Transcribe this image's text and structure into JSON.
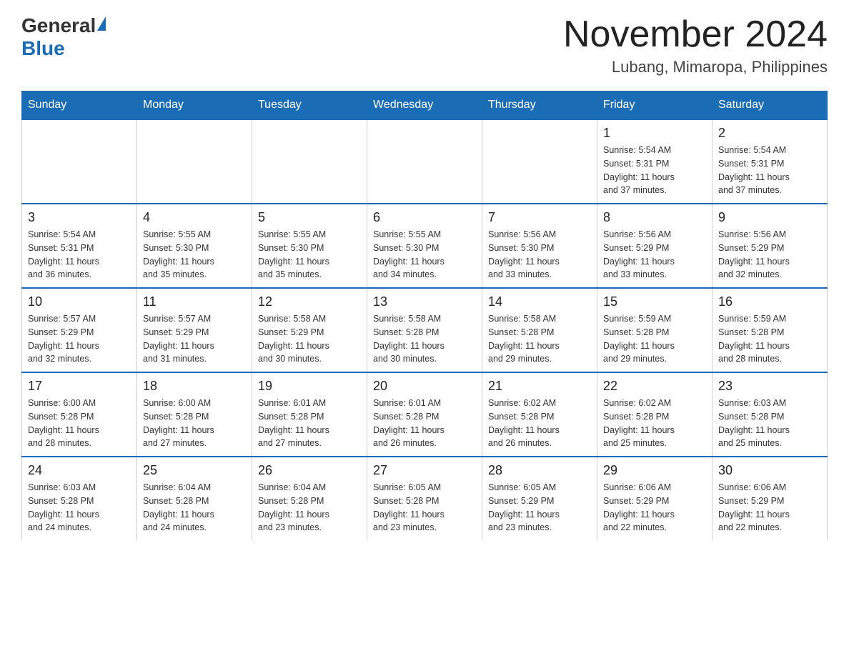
{
  "header": {
    "logo_general": "General",
    "logo_blue": "Blue",
    "title": "November 2024",
    "subtitle": "Lubang, Mimaropa, Philippines"
  },
  "weekdays": [
    "Sunday",
    "Monday",
    "Tuesday",
    "Wednesday",
    "Thursday",
    "Friday",
    "Saturday"
  ],
  "weeks": [
    [
      {
        "day": "",
        "info": ""
      },
      {
        "day": "",
        "info": ""
      },
      {
        "day": "",
        "info": ""
      },
      {
        "day": "",
        "info": ""
      },
      {
        "day": "",
        "info": ""
      },
      {
        "day": "1",
        "info": "Sunrise: 5:54 AM\nSunset: 5:31 PM\nDaylight: 11 hours\nand 37 minutes."
      },
      {
        "day": "2",
        "info": "Sunrise: 5:54 AM\nSunset: 5:31 PM\nDaylight: 11 hours\nand 37 minutes."
      }
    ],
    [
      {
        "day": "3",
        "info": "Sunrise: 5:54 AM\nSunset: 5:31 PM\nDaylight: 11 hours\nand 36 minutes."
      },
      {
        "day": "4",
        "info": "Sunrise: 5:55 AM\nSunset: 5:30 PM\nDaylight: 11 hours\nand 35 minutes."
      },
      {
        "day": "5",
        "info": "Sunrise: 5:55 AM\nSunset: 5:30 PM\nDaylight: 11 hours\nand 35 minutes."
      },
      {
        "day": "6",
        "info": "Sunrise: 5:55 AM\nSunset: 5:30 PM\nDaylight: 11 hours\nand 34 minutes."
      },
      {
        "day": "7",
        "info": "Sunrise: 5:56 AM\nSunset: 5:30 PM\nDaylight: 11 hours\nand 33 minutes."
      },
      {
        "day": "8",
        "info": "Sunrise: 5:56 AM\nSunset: 5:29 PM\nDaylight: 11 hours\nand 33 minutes."
      },
      {
        "day": "9",
        "info": "Sunrise: 5:56 AM\nSunset: 5:29 PM\nDaylight: 11 hours\nand 32 minutes."
      }
    ],
    [
      {
        "day": "10",
        "info": "Sunrise: 5:57 AM\nSunset: 5:29 PM\nDaylight: 11 hours\nand 32 minutes."
      },
      {
        "day": "11",
        "info": "Sunrise: 5:57 AM\nSunset: 5:29 PM\nDaylight: 11 hours\nand 31 minutes."
      },
      {
        "day": "12",
        "info": "Sunrise: 5:58 AM\nSunset: 5:29 PM\nDaylight: 11 hours\nand 30 minutes."
      },
      {
        "day": "13",
        "info": "Sunrise: 5:58 AM\nSunset: 5:28 PM\nDaylight: 11 hours\nand 30 minutes."
      },
      {
        "day": "14",
        "info": "Sunrise: 5:58 AM\nSunset: 5:28 PM\nDaylight: 11 hours\nand 29 minutes."
      },
      {
        "day": "15",
        "info": "Sunrise: 5:59 AM\nSunset: 5:28 PM\nDaylight: 11 hours\nand 29 minutes."
      },
      {
        "day": "16",
        "info": "Sunrise: 5:59 AM\nSunset: 5:28 PM\nDaylight: 11 hours\nand 28 minutes."
      }
    ],
    [
      {
        "day": "17",
        "info": "Sunrise: 6:00 AM\nSunset: 5:28 PM\nDaylight: 11 hours\nand 28 minutes."
      },
      {
        "day": "18",
        "info": "Sunrise: 6:00 AM\nSunset: 5:28 PM\nDaylight: 11 hours\nand 27 minutes."
      },
      {
        "day": "19",
        "info": "Sunrise: 6:01 AM\nSunset: 5:28 PM\nDaylight: 11 hours\nand 27 minutes."
      },
      {
        "day": "20",
        "info": "Sunrise: 6:01 AM\nSunset: 5:28 PM\nDaylight: 11 hours\nand 26 minutes."
      },
      {
        "day": "21",
        "info": "Sunrise: 6:02 AM\nSunset: 5:28 PM\nDaylight: 11 hours\nand 26 minutes."
      },
      {
        "day": "22",
        "info": "Sunrise: 6:02 AM\nSunset: 5:28 PM\nDaylight: 11 hours\nand 25 minutes."
      },
      {
        "day": "23",
        "info": "Sunrise: 6:03 AM\nSunset: 5:28 PM\nDaylight: 11 hours\nand 25 minutes."
      }
    ],
    [
      {
        "day": "24",
        "info": "Sunrise: 6:03 AM\nSunset: 5:28 PM\nDaylight: 11 hours\nand 24 minutes."
      },
      {
        "day": "25",
        "info": "Sunrise: 6:04 AM\nSunset: 5:28 PM\nDaylight: 11 hours\nand 24 minutes."
      },
      {
        "day": "26",
        "info": "Sunrise: 6:04 AM\nSunset: 5:28 PM\nDaylight: 11 hours\nand 23 minutes."
      },
      {
        "day": "27",
        "info": "Sunrise: 6:05 AM\nSunset: 5:28 PM\nDaylight: 11 hours\nand 23 minutes."
      },
      {
        "day": "28",
        "info": "Sunrise: 6:05 AM\nSunset: 5:29 PM\nDaylight: 11 hours\nand 23 minutes."
      },
      {
        "day": "29",
        "info": "Sunrise: 6:06 AM\nSunset: 5:29 PM\nDaylight: 11 hours\nand 22 minutes."
      },
      {
        "day": "30",
        "info": "Sunrise: 6:06 AM\nSunset: 5:29 PM\nDaylight: 11 hours\nand 22 minutes."
      }
    ]
  ]
}
